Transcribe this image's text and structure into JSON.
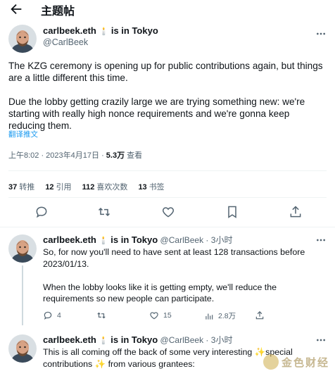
{
  "header": {
    "title": "主题帖"
  },
  "main_tweet": {
    "display_name": "carlbeek.eth",
    "status_text": "is in Tokyo",
    "handle": "@CarlBeek",
    "body": [
      "The KZG ceremony is opening up for public contributions again, but things are a little different this time.",
      "Due the lobby getting crazily large we are trying something new: we're starting with really high nonce requirements and we're gonna keep reducing them."
    ],
    "translate": "翻译推文",
    "time": "上午8:02 · 2023年4月17日 · ",
    "views_count": "5.3万",
    "views_label": " 查看"
  },
  "stats": [
    {
      "count": "37",
      "label": "转推"
    },
    {
      "count": "12",
      "label": "引用"
    },
    {
      "count": "112",
      "label": "喜欢次数"
    },
    {
      "count": "13",
      "label": "书签"
    }
  ],
  "replies": [
    {
      "display_name": "carlbeek.eth",
      "status_text": "is in Tokyo",
      "handle": "@CarlBeek",
      "time": "3小时",
      "body": [
        "So, for now you'll need to have sent at least 128 transactions before 2023/01/13.",
        "When the lobby looks like it is getting empty, we'll reduce the requirements so new people can participate."
      ],
      "actions": {
        "replies": "4",
        "retweets": "",
        "likes": "15",
        "views": "2.8万"
      }
    },
    {
      "display_name": "carlbeek.eth",
      "status_text": "is in Tokyo",
      "handle": "@CarlBeek",
      "time": "3小时",
      "body_line1_a": "This is all coming off the back of some very interesting ",
      "body_line1_b": "special",
      "body_line2_a": "contributions ",
      "body_line2_b": " from various grantees:"
    }
  ],
  "watermark": {
    "text": "金色财经"
  }
}
